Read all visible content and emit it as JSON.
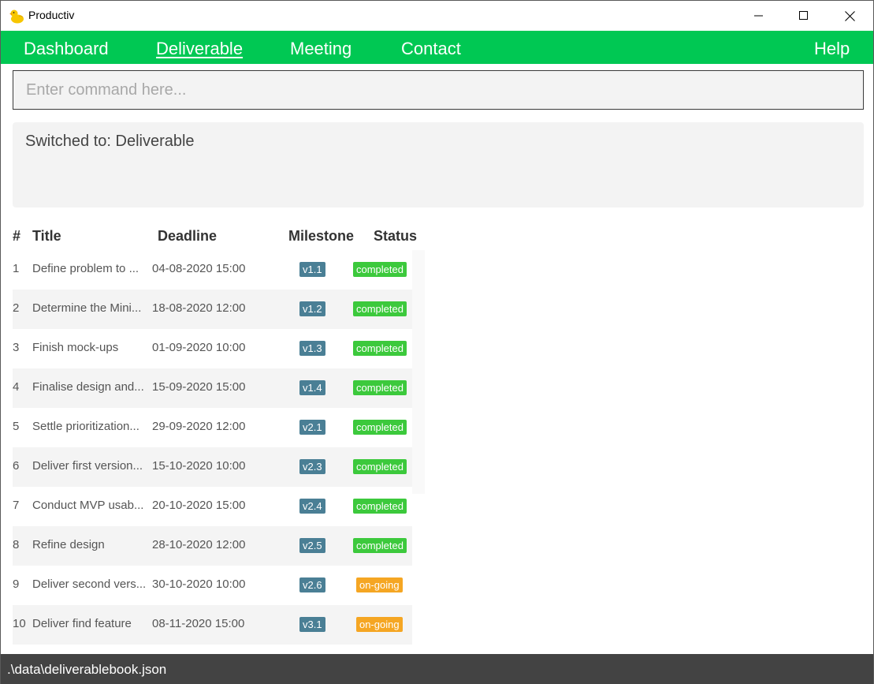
{
  "window": {
    "title": "Productiv",
    "icon": "rubber-duck-icon"
  },
  "nav": {
    "items": [
      {
        "label": "Dashboard"
      },
      {
        "label": "Deliverable"
      },
      {
        "label": "Meeting"
      },
      {
        "label": "Contact"
      }
    ],
    "help_label": "Help",
    "active": "Deliverable"
  },
  "command": {
    "placeholder": "Enter command here...",
    "value": ""
  },
  "result": {
    "text": "Switched to: Deliverable"
  },
  "table": {
    "headers": {
      "index": "#",
      "title": "Title",
      "deadline": "Deadline",
      "milestone": "Milestone",
      "status": "Status"
    },
    "rows": [
      {
        "index": "1",
        "title": "Define problem to ...",
        "deadline": "04-08-2020 15:00",
        "milestone": "v1.1",
        "status": "completed"
      },
      {
        "index": "2",
        "title": "Determine the Mini...",
        "deadline": "18-08-2020 12:00",
        "milestone": "v1.2",
        "status": "completed"
      },
      {
        "index": "3",
        "title": "Finish mock-ups",
        "deadline": "01-09-2020 10:00",
        "milestone": "v1.3",
        "status": "completed"
      },
      {
        "index": "4",
        "title": "Finalise design and...",
        "deadline": "15-09-2020 15:00",
        "milestone": "v1.4",
        "status": "completed"
      },
      {
        "index": "5",
        "title": "Settle prioritization...",
        "deadline": "29-09-2020 12:00",
        "milestone": "v2.1",
        "status": "completed"
      },
      {
        "index": "6",
        "title": "Deliver first version...",
        "deadline": "15-10-2020 10:00",
        "milestone": "v2.3",
        "status": "completed"
      },
      {
        "index": "7",
        "title": "Conduct MVP usab...",
        "deadline": "20-10-2020 15:00",
        "milestone": "v2.4",
        "status": "completed"
      },
      {
        "index": "8",
        "title": "Refine design",
        "deadline": "28-10-2020 12:00",
        "milestone": "v2.5",
        "status": "completed"
      },
      {
        "index": "9",
        "title": "Deliver second vers...",
        "deadline": "30-10-2020 10:00",
        "milestone": "v2.6",
        "status": "on-going"
      },
      {
        "index": "10",
        "title": "Deliver find feature",
        "deadline": "08-11-2020 15:00",
        "milestone": "v3.1",
        "status": "on-going"
      }
    ]
  },
  "statusbar": {
    "path": ".\\data\\deliverablebook.json"
  },
  "colors": {
    "nav_bg": "#00c853",
    "milestone_badge": "#4a7f95",
    "completed_badge": "#3cc93c",
    "ongoing_badge": "#f5a623",
    "statusbar_bg": "#434343"
  }
}
